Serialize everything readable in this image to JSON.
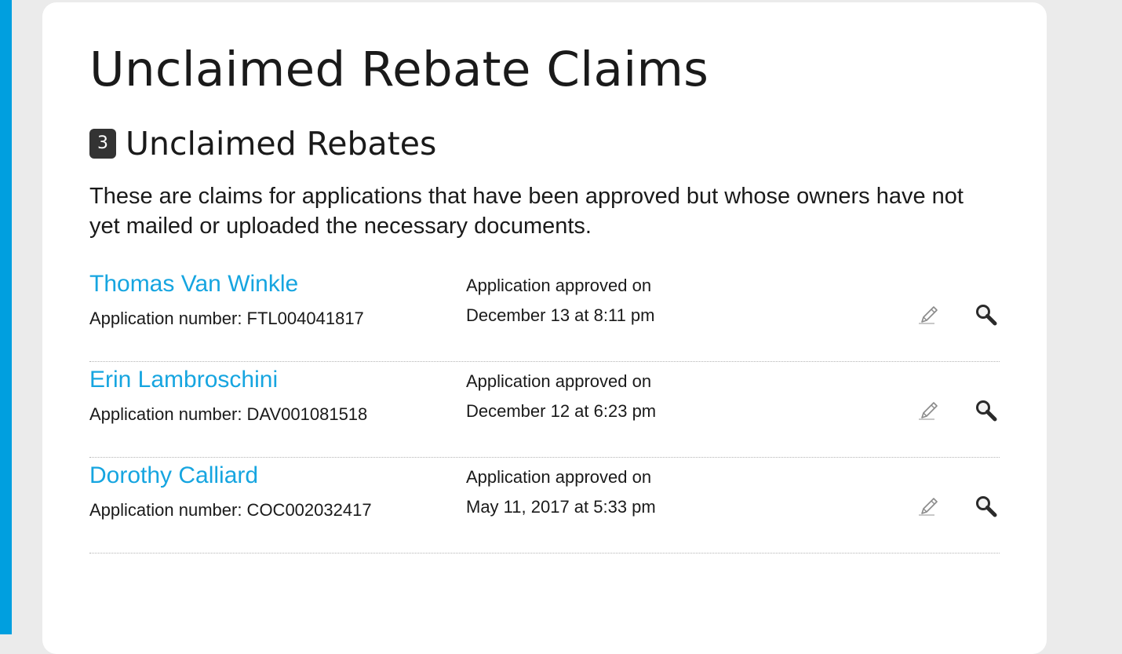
{
  "page": {
    "title": "Unclaimed Rebate Claims"
  },
  "section": {
    "count": "3",
    "title": "Unclaimed Rebates",
    "description": "These are claims for applications that have been approved but whose owners have not yet mailed or uploaded the necessary documents."
  },
  "claims": [
    {
      "name": "Thomas Van Winkle",
      "application_number": "Application number: FTL004041817",
      "approved_label": "Application approved on",
      "approved_date": "December 13 at 8:11 pm"
    },
    {
      "name": "Erin Lambroschini",
      "application_number": "Application number: DAV001081518",
      "approved_label": "Application approved on",
      "approved_date": "December 12 at 6:23 pm"
    },
    {
      "name": "Dorothy Calliard",
      "application_number": "Application number: COC002032417",
      "approved_label": "Application approved on",
      "approved_date": "May 11, 2017 at 5:33 pm"
    }
  ],
  "icons": {
    "edit": "pencil-icon",
    "view": "magnifier-icon"
  },
  "colors": {
    "accent_stripe": "#009fdf",
    "link": "#16a5e0",
    "badge": "#333333",
    "background": "#ebebeb"
  }
}
